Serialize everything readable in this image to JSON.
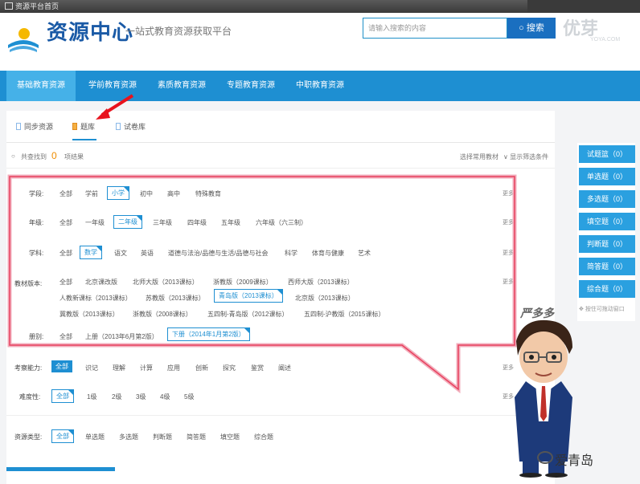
{
  "titlebar": {
    "title": "资源平台首页"
  },
  "header": {
    "logo_text": "资源中心",
    "slogan": "一站式教育资源获取平台",
    "search_placeholder": "请输入搜索的内容",
    "search_button": "搜索",
    "watermark": "优芽",
    "watermark_sub": "YOYA.COM"
  },
  "nav": {
    "items": [
      "基础教育资源",
      "学前教育资源",
      "素质教育资源",
      "专题教育资源",
      "中职教育资源"
    ]
  },
  "tabs": [
    "同步资源",
    "题库",
    "试卷库"
  ],
  "results": {
    "prefix": "共查找到",
    "count": "0",
    "suffix": "项结果",
    "right1": "选择常用教材",
    "right2": "显示筛选条件"
  },
  "filters": {
    "xueduan": {
      "label": "学段:",
      "options": [
        "全部",
        "学前",
        "小学",
        "初中",
        "高中",
        "特殊教育"
      ]
    },
    "nianji": {
      "label": "年级:",
      "options": [
        "全部",
        "一年级",
        "二年级",
        "三年级",
        "四年级",
        "五年级",
        "六年级（六三制）"
      ]
    },
    "xueke": {
      "label": "学科:",
      "options": [
        "全部",
        "数学",
        "语文",
        "英语",
        "道德与法治/品德与生活/品德与社会",
        "科学",
        "体育与健康",
        "艺术"
      ]
    },
    "jiaocai": {
      "label": "教材版本:",
      "row1": [
        "全部",
        "北京课改版",
        "北师大版（2013课标）",
        "浙教版（2009课标）",
        "西师大版（2013课标）"
      ],
      "row2": [
        "人教新课标（2013课标）",
        "苏教版（2013课标）",
        "青岛版（2013课标）",
        "北京版（2013课标）"
      ],
      "row3": [
        "冀教版（2013课标）",
        "浙教版（2008课标）",
        "五四制-青岛版（2012课标）",
        "五四制-沪教版（2015课标）"
      ]
    },
    "cece": {
      "label": "册别:",
      "options": [
        "全部",
        "上册（2013年6月第2版）",
        "下册（2014年1月第2版）"
      ]
    },
    "nengli": {
      "label": "考察能力:",
      "options": [
        "全部",
        "识记",
        "理解",
        "计算",
        "应用",
        "创新",
        "探究",
        "鉴赏",
        "阐述"
      ]
    },
    "nandu": {
      "label": "难度性:",
      "options": [
        "全部",
        "1级",
        "2级",
        "3级",
        "4级",
        "5级"
      ]
    },
    "leixing": {
      "label": "资源类型:",
      "options": [
        "全部",
        "单选题",
        "多选题",
        "判断题",
        "简答题",
        "填空题",
        "综合题"
      ]
    },
    "more": "更多"
  },
  "sidebar": {
    "buttons": [
      "试题篮（0）",
      "单选题（0）",
      "多选题（0）",
      "填空题（0）",
      "判断题（0）",
      "简答题（0）",
      "综合题（0）"
    ],
    "note": "按住可拖动窗口"
  },
  "overlay": {
    "char_name": "严多多",
    "account": "爱青岛"
  }
}
